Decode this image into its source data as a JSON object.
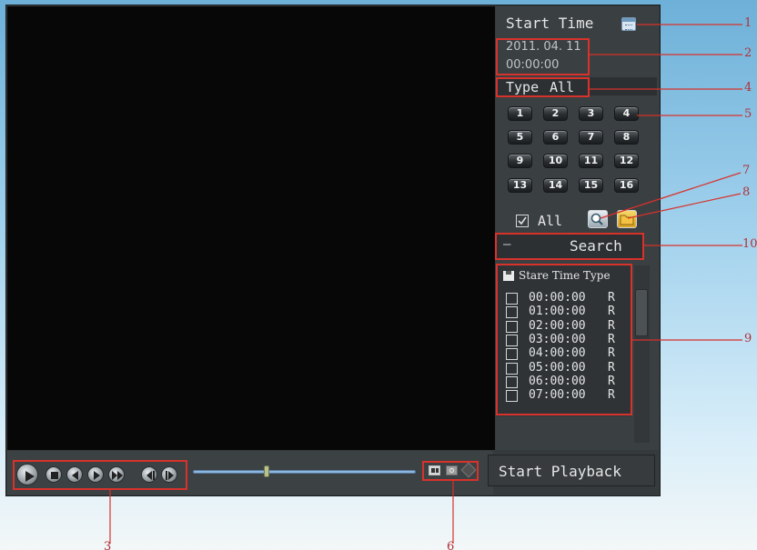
{
  "panel": {
    "start_time_label": "Start Time",
    "date": "2011. 04. 11",
    "time": "00:00:00",
    "type_label": "Type",
    "type_value": "All",
    "channels": [
      "1",
      "2",
      "3",
      "4",
      "5",
      "6",
      "7",
      "8",
      "9",
      "10",
      "11",
      "12",
      "13",
      "14",
      "15",
      "16"
    ],
    "all_label": "All",
    "search_label": "Search",
    "search_prefix": "—"
  },
  "results": {
    "header": "Stare Time Type",
    "rows": [
      {
        "time": "00:00:00",
        "type": "R"
      },
      {
        "time": "01:00:00",
        "type": "R"
      },
      {
        "time": "02:00:00",
        "type": "R"
      },
      {
        "time": "03:00:00",
        "type": "R"
      },
      {
        "time": "04:00:00",
        "type": "R"
      },
      {
        "time": "05:00:00",
        "type": "R"
      },
      {
        "time": "06:00:00",
        "type": "R"
      },
      {
        "time": "07:00:00",
        "type": "R"
      }
    ]
  },
  "controls": {
    "start_playback_label": "Start Playback",
    "progress": 0.33
  },
  "callouts": [
    "1",
    "2",
    "3",
    "4",
    "5",
    "6",
    "7",
    "8",
    "9",
    "10"
  ],
  "colors": {
    "annotation": "#d8322b",
    "panel": "#3a3f42",
    "video": "#070707"
  }
}
